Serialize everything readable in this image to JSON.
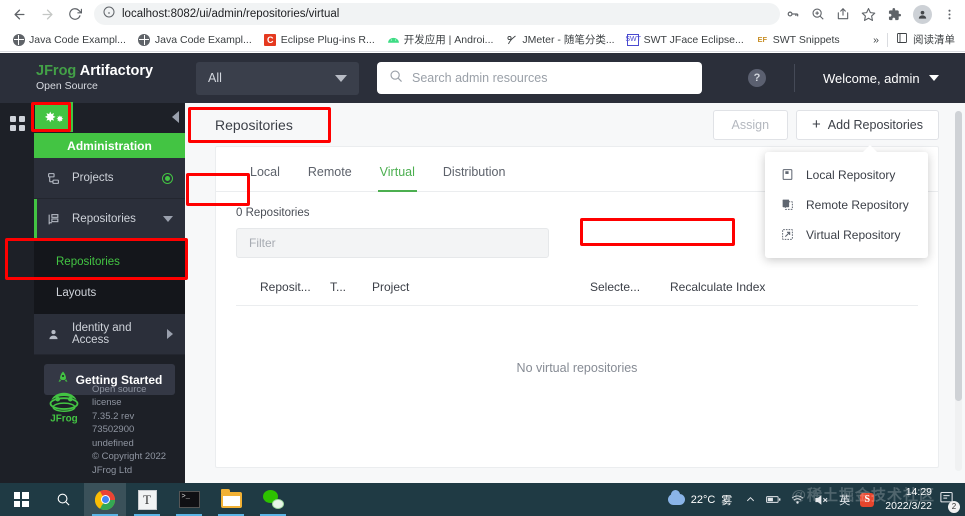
{
  "browser": {
    "url": "localhost:8082/ui/admin/repositories/virtual",
    "back_label": "Back",
    "forward_label": "Forward",
    "reload_label": "Reload",
    "site_info_label": "View site information",
    "omni_icons": [
      "password-key-icon",
      "zoom-icon",
      "share-icon",
      "bookmark-star-icon"
    ],
    "extensions_label": "Extensions",
    "profile_label": "Profile",
    "menu_label": "Customize and control Chrome",
    "bookmarks": [
      {
        "label": "Java Code Exampl...",
        "icon": "globe-icon"
      },
      {
        "label": "Java Code Exampl...",
        "icon": "globe-icon"
      },
      {
        "label": "Eclipse Plug-ins R...",
        "icon": "c-letter-icon"
      },
      {
        "label": "开发应用 | Androi...",
        "icon": "android-icon"
      },
      {
        "label": "JMeter - 随笔分类...",
        "icon": "jmeter-icon"
      },
      {
        "label": "SWT JFace Eclipse...",
        "icon": "swt-icon"
      },
      {
        "label": "SWT Snippets",
        "icon": "ef-icon"
      }
    ],
    "overflow_label": "»",
    "reading_list_label": "阅读清单"
  },
  "app": {
    "logo": {
      "brand": "JFrog",
      "product": "Artifactory",
      "edition": "Open Source"
    },
    "scope_select": {
      "value": "All"
    },
    "search": {
      "placeholder": "Search admin resources",
      "icon": "search-icon"
    },
    "help_label": "?",
    "user_menu": {
      "label": "Welcome, admin"
    }
  },
  "sidebar": {
    "rail_icon": "apps-grid-icon",
    "admin_icon": "gear-icon",
    "admin_label": "Administration",
    "collapse_label": "Collapse",
    "items": [
      {
        "label": "Projects",
        "icon": "projects-icon",
        "right": "target-dot-icon"
      },
      {
        "label": "Repositories",
        "icon": "repositories-icon",
        "right": "chevron-down-icon",
        "expanded": true
      },
      {
        "label": "Identity and Access",
        "icon": "user-icon",
        "right": "chevron-right-icon"
      }
    ],
    "subitems": [
      {
        "label": "Repositories",
        "selected": true
      },
      {
        "label": "Layouts",
        "selected": false
      }
    ],
    "getting_started": {
      "label": "Getting Started",
      "icon": "rocket-icon"
    },
    "license": {
      "line1": "Open source license",
      "line2": "7.35.2 rev 73502900",
      "line3": "undefined",
      "line4": "© Copyright 2022",
      "line5": "JFrog Ltd"
    }
  },
  "main": {
    "page_title": "Repositories",
    "assign_button": "Assign",
    "add_button": "Add Repositories",
    "add_button_icon": "plus-icon",
    "dropdown": {
      "items": [
        {
          "label": "Local Repository",
          "icon": "local-repo-icon",
          "highlighted": false
        },
        {
          "label": "Remote Repository",
          "icon": "remote-repo-icon",
          "highlighted": false
        },
        {
          "label": "Virtual Repository",
          "icon": "virtual-repo-icon",
          "highlighted": true
        }
      ]
    },
    "tabs": [
      {
        "label": "Local",
        "active": false
      },
      {
        "label": "Remote",
        "active": false
      },
      {
        "label": "Virtual",
        "active": true
      },
      {
        "label": "Distribution",
        "active": false
      }
    ],
    "repo_count": "0 Repositories",
    "filter": {
      "placeholder": "Filter"
    },
    "table_headers": [
      "Reposit...",
      "T...",
      "Project",
      "Selecte...",
      "Recalculate Index"
    ],
    "empty_state": "No virtual repositories"
  },
  "taskbar": {
    "start_label": "Start",
    "search_label": "Search",
    "apps": [
      {
        "name": "chrome",
        "active": true
      },
      {
        "name": "text-editor",
        "active": false
      },
      {
        "name": "terminal",
        "active": false
      },
      {
        "name": "file-explorer",
        "active": false
      },
      {
        "name": "wechat",
        "active": false
      }
    ],
    "weather_temp": "22°C",
    "weather_condition": "雾",
    "tray_icons": [
      "chevron-up-icon",
      "battery-icon",
      "wifi-icon",
      "volume-muted-icon"
    ],
    "ime_label": "英",
    "sogou_label": "S",
    "time": "14:29",
    "date": "2022/3/22",
    "notification_count": "2",
    "watermark": "@稀土掘金技术社区"
  },
  "colors": {
    "jfrog_green": "#43c443",
    "dark_navy": "#2b2f3a",
    "darker_navy": "#1d2027",
    "annotation_red": "#ff0000",
    "taskbar": "#1f3a44"
  }
}
